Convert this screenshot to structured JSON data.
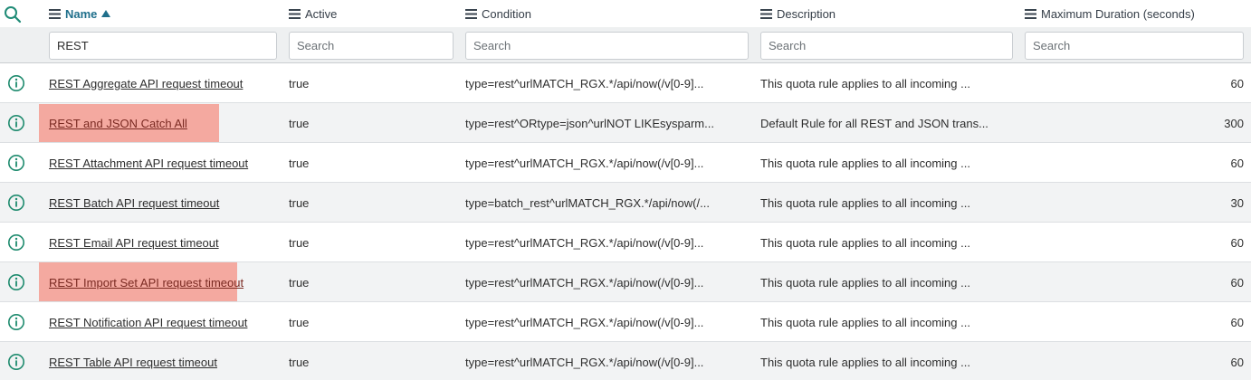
{
  "header": {
    "columns": [
      {
        "label": "Name",
        "sorted": true
      },
      {
        "label": "Active"
      },
      {
        "label": "Condition"
      },
      {
        "label": "Description"
      },
      {
        "label": "Maximum Duration (seconds)"
      }
    ]
  },
  "filters": {
    "name_value": "REST",
    "active_placeholder": "Search",
    "condition_placeholder": "Search",
    "description_placeholder": "Search",
    "duration_placeholder": "Search"
  },
  "rows": [
    {
      "name": "REST Aggregate API request timeout",
      "active": "true",
      "condition": "type=rest^urlMATCH_RGX.*/api/now(/v[0-9]...",
      "description": "This quota rule applies to all incoming ...",
      "duration": "60",
      "highlighted": false
    },
    {
      "name": "REST and JSON Catch All",
      "active": "true",
      "condition": "type=rest^ORtype=json^urlNOT LIKEsysparm...",
      "description": "Default Rule for all REST and JSON trans...",
      "duration": "300",
      "highlighted": true
    },
    {
      "name": "REST Attachment API request timeout",
      "active": "true",
      "condition": "type=rest^urlMATCH_RGX.*/api/now(/v[0-9]...",
      "description": "This quota rule applies to all incoming ...",
      "duration": "60",
      "highlighted": false
    },
    {
      "name": "REST Batch API request timeout",
      "active": "true",
      "condition": "type=batch_rest^urlMATCH_RGX.*/api/now(/...",
      "description": "This quota rule applies to all incoming ...",
      "duration": "30",
      "highlighted": false
    },
    {
      "name": "REST Email API request timeout",
      "active": "true",
      "condition": "type=rest^urlMATCH_RGX.*/api/now(/v[0-9]...",
      "description": "This quota rule applies to all incoming ...",
      "duration": "60",
      "highlighted": false
    },
    {
      "name": "REST Import Set API request timeout",
      "active": "true",
      "condition": "type=rest^urlMATCH_RGX.*/api/now(/v[0-9]...",
      "description": "This quota rule applies to all incoming ...",
      "duration": "60",
      "highlighted": true
    },
    {
      "name": "REST Notification API request timeout",
      "active": "true",
      "condition": "type=rest^urlMATCH_RGX.*/api/now(/v[0-9]...",
      "description": "This quota rule applies to all incoming ...",
      "duration": "60",
      "highlighted": false
    },
    {
      "name": "REST Table API request timeout",
      "active": "true",
      "condition": "type=rest^urlMATCH_RGX.*/api/now(/v[0-9]...",
      "description": "This quota rule applies to all incoming ...",
      "duration": "60",
      "highlighted": false
    }
  ],
  "icons": {
    "search": "search-icon",
    "column_menu": "hamburger-menu-icon",
    "sort": "sort-ascending-icon",
    "row_info": "info-circle-icon"
  },
  "colors": {
    "accent": "#1f6f8b",
    "info_icon": "#1e8b6e",
    "highlight": "#f4a9a0",
    "row_alt": "#f2f3f4"
  }
}
